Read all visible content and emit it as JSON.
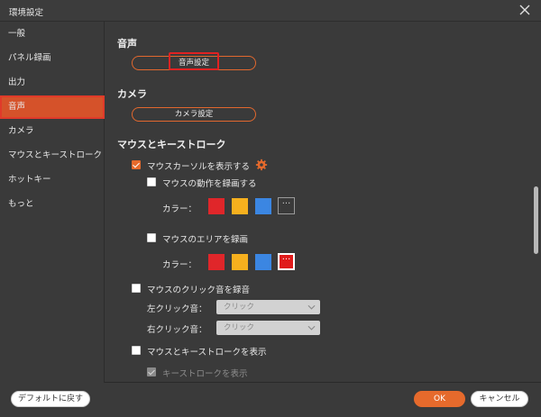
{
  "window": {
    "title": "環境設定"
  },
  "sidebar": {
    "items": [
      {
        "label": "一般",
        "active": false
      },
      {
        "label": "パネル録画",
        "active": false
      },
      {
        "label": "出力",
        "active": false
      },
      {
        "label": "音声",
        "active": true
      },
      {
        "label": "カメラ",
        "active": false
      },
      {
        "label": "マウスとキーストローク",
        "active": false
      },
      {
        "label": "ホットキー",
        "active": false
      },
      {
        "label": "もっと",
        "active": false
      }
    ]
  },
  "audio": {
    "title": "音声",
    "settings_button": "音声設定"
  },
  "camera": {
    "title": "カメラ",
    "settings_button": "カメラ設定"
  },
  "mouse": {
    "title": "マウスとキーストローク",
    "show_cursor": {
      "label": "マウスカーソルを表示する",
      "checked": true
    },
    "record_motion": {
      "label": "マウスの動作を録画する",
      "checked": false,
      "color_label": "カラー："
    },
    "record_area": {
      "label": "マウスのエリアを録画",
      "checked": false,
      "color_label": "カラー："
    },
    "record_click_sound": {
      "label": "マウスのクリック音を録音",
      "checked": false
    },
    "left_click": {
      "label": "左クリック音：",
      "value": "クリック"
    },
    "right_click": {
      "label": "右クリック音：",
      "value": "クリック"
    },
    "show_mouse_keystroke": {
      "label": "マウスとキーストロークを表示",
      "checked": false
    },
    "show_keystroke": {
      "label": "キーストロークを表示",
      "checked": true,
      "disabled": true
    },
    "more_glyph": "···"
  },
  "colors": {
    "red": "#e0262a",
    "yellow": "#f6b01e",
    "blue": "#3b86e2",
    "accent": "#e66a2c"
  },
  "footer": {
    "reset_button": "デフォルトに戻す",
    "ok_button": "OK",
    "cancel_button": "キャンセル"
  }
}
